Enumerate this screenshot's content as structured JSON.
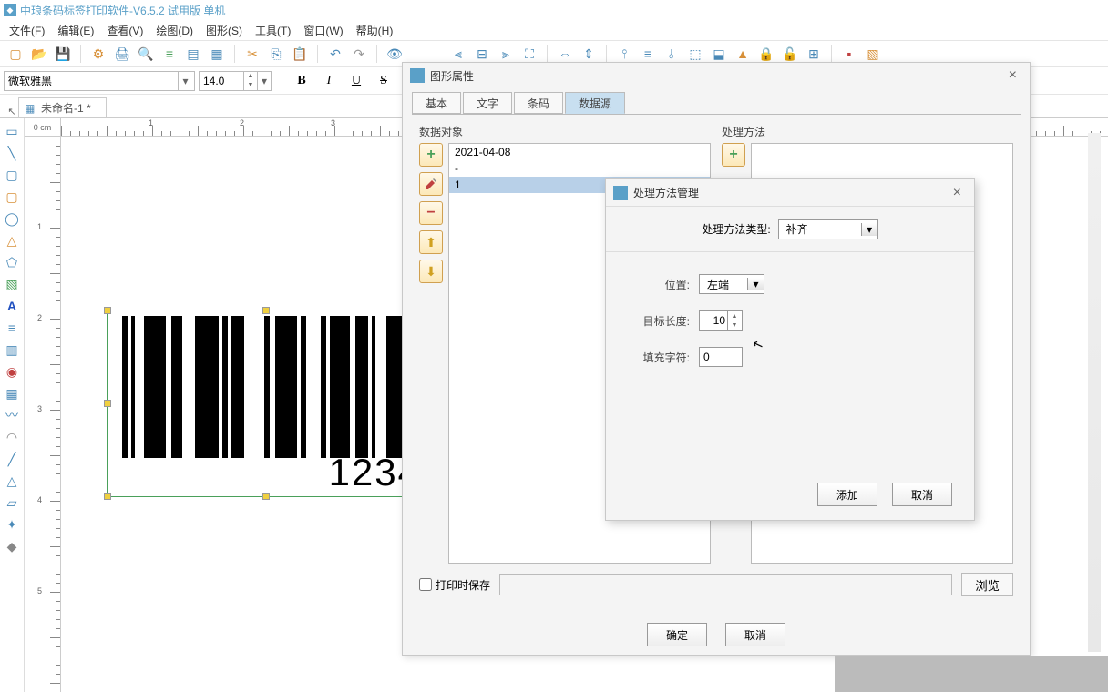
{
  "app": {
    "title": "中琅条码标签打印软件-V6.5.2 试用版 单机"
  },
  "menu": {
    "file": "文件(F)",
    "edit": "编辑(E)",
    "view": "查看(V)",
    "draw": "绘图(D)",
    "shape": "图形(S)",
    "tool": "工具(T)",
    "window": "窗口(W)",
    "help": "帮助(H)"
  },
  "format": {
    "font": "微软雅黑",
    "size": "14.0"
  },
  "ruler": {
    "unit": "0 cm"
  },
  "doc_tab": "未命名-1 *",
  "barcode_text": "1234",
  "prop_dialog": {
    "title": "图形属性",
    "tabs": {
      "basic": "基本",
      "text": "文字",
      "barcode": "条码",
      "data": "数据源"
    },
    "data_object": {
      "title": "数据对象",
      "items": [
        "2021-04-08",
        "-",
        "1"
      ]
    },
    "process": {
      "title": "处理方法"
    },
    "print_save": "打印时保存",
    "browse": "浏览",
    "ok": "确定",
    "cancel": "取消"
  },
  "proc_dialog": {
    "title": "处理方法管理",
    "type_label": "处理方法类型:",
    "type_value": "补齐",
    "pos_label": "位置:",
    "pos_value": "左端",
    "length_label": "目标长度:",
    "length_value": "10",
    "fill_label": "填充字符:",
    "fill_value": "0",
    "add": "添加",
    "cancel": "取消"
  }
}
